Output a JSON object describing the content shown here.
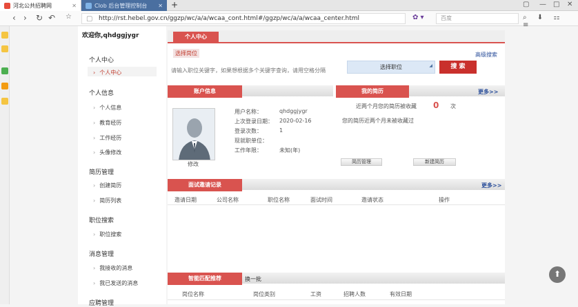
{
  "browser": {
    "tabs": [
      {
        "label": "河北公共招聘网",
        "active": true
      },
      {
        "label": "Clob 后台管理控制台",
        "active": false
      }
    ],
    "url": "http://rst.hebel.gov.cn/ggzp/wc/a/a/wcaa_cont.html#/ggzp/wc/a/a/wcaa_center.html",
    "search_placeholder": "百度"
  },
  "sidebar": {
    "welcome": "欢迎你,qhdggjygr",
    "sections": [
      {
        "title": "个人中心",
        "items": [
          {
            "label": "个人中心",
            "active": true
          }
        ]
      },
      {
        "title": "个人信息",
        "items": [
          {
            "label": "个人信息"
          },
          {
            "label": "教育经历"
          },
          {
            "label": "工作经历"
          },
          {
            "label": "头像修改"
          }
        ]
      },
      {
        "title": "简历管理",
        "items": [
          {
            "label": "创建简历"
          },
          {
            "label": "简历列表"
          }
        ]
      },
      {
        "title": "职位搜索",
        "items": [
          {
            "label": "职位搜索"
          }
        ]
      },
      {
        "title": "消息管理",
        "items": [
          {
            "label": "我接收的消息"
          },
          {
            "label": "我已发送的消息"
          }
        ]
      },
      {
        "title": "应聘管理",
        "items": []
      }
    ]
  },
  "main": {
    "header": "个人中心",
    "position_tag": "选择岗位",
    "advanced_search": "高级搜索",
    "search_placeholder": "请输入职位关键字，如果想根据多个关键字查询，请用空格分隔",
    "select_position": "选择职位",
    "search_button": "搜 索",
    "account": {
      "title": "账户信息",
      "fields": [
        {
          "label": "用户名称：",
          "value": "qhdggjygr"
        },
        {
          "label": "上次登录日期：",
          "value": "2020-02-16"
        },
        {
          "label": "登录次数：",
          "value": "1"
        },
        {
          "label": "现就职单位：",
          "value": ""
        },
        {
          "label": "工作年限：",
          "value": "未知(年)"
        }
      ],
      "edit": "修改"
    },
    "resume": {
      "title": "我的简历",
      "more": "更多>>",
      "count_prefix": "近两个月您的简历被收藏",
      "count": "0",
      "count_unit": "次",
      "not_invited": "您的简历近两个月未被收藏过",
      "manage_btn": "简历管理",
      "new_btn": "新建简历"
    },
    "interview": {
      "title": "面试邀请记录",
      "more": "更多>>",
      "columns": [
        "邀请日期",
        "公司名称",
        "职位名称",
        "面试时间",
        "邀请状态",
        "操作"
      ]
    },
    "recommend": {
      "title": "智能匹配推荐",
      "refresh": "换一批",
      "columns": [
        "岗位名称",
        "岗位类别",
        "工资",
        "招聘人数",
        "有效日期"
      ]
    }
  },
  "colors": {
    "accent_red": "#d9534f",
    "link_blue": "#2a4e9a"
  }
}
